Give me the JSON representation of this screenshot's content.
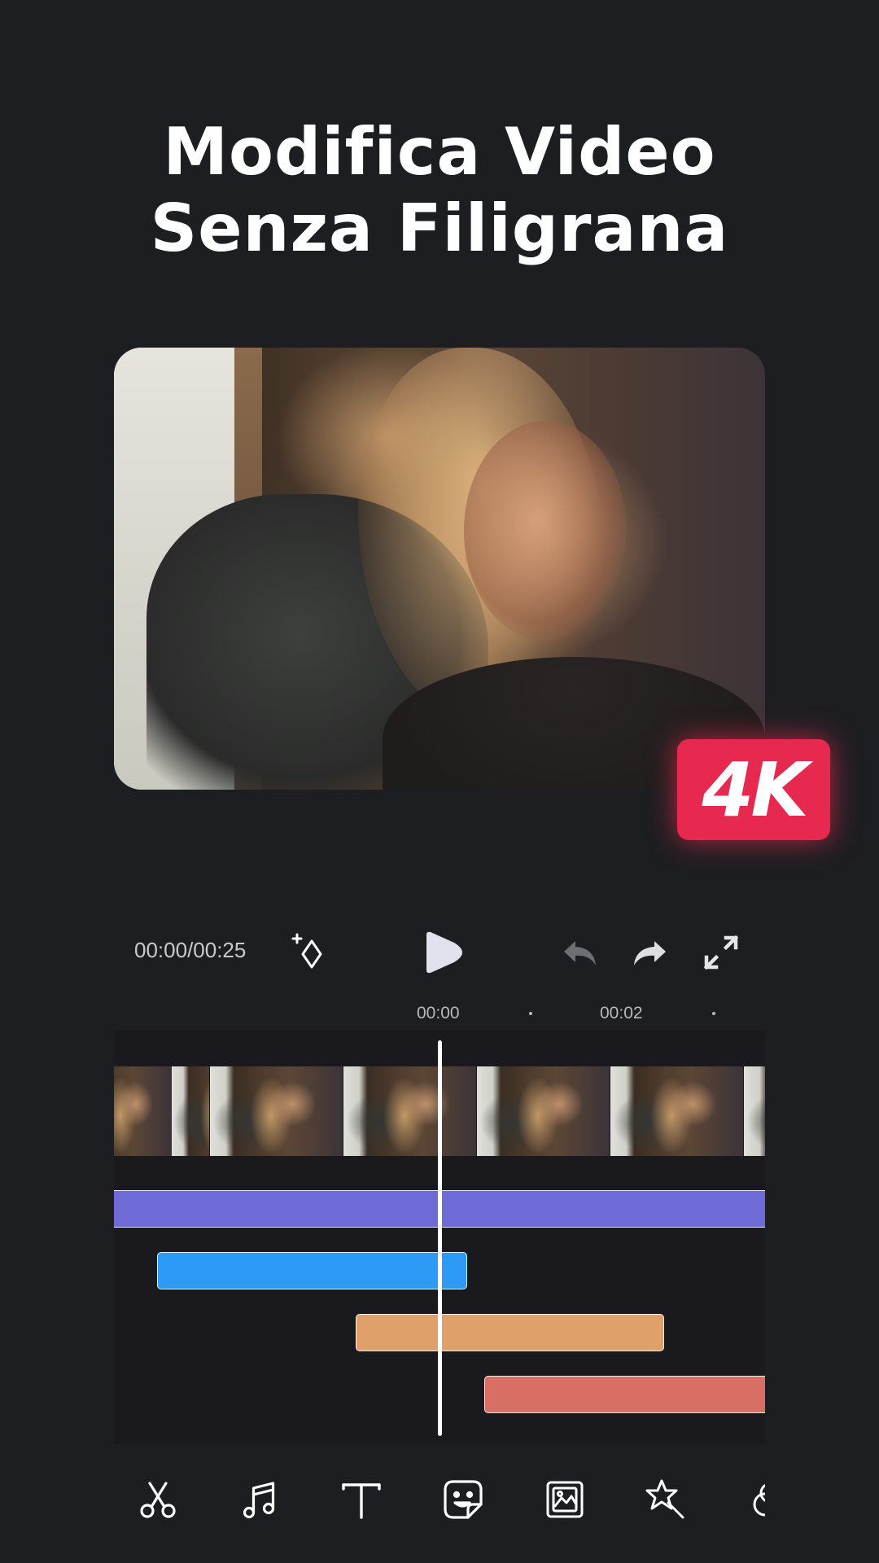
{
  "headline": {
    "line1": "Modifica Video",
    "line2": "Senza Filigrana"
  },
  "preview": {
    "badge": "4K",
    "badge_color": "#e8294f"
  },
  "player": {
    "time": "00:00/00:25",
    "icons": [
      "add-keyframe-icon",
      "play-icon",
      "undo-icon",
      "redo-icon",
      "fullscreen-icon"
    ]
  },
  "timeline": {
    "ruler_labels": [
      "00:00",
      "00:02"
    ],
    "tracks": [
      {
        "color": "#6f6bd6"
      },
      {
        "color": "#2d9bf5"
      },
      {
        "color": "#dfa06a"
      },
      {
        "color": "#d86f64"
      }
    ]
  },
  "toolbar": {
    "tools": [
      "scissors-icon",
      "music-note-icon",
      "text-icon",
      "sticker-icon",
      "image-icon",
      "magic-wand-icon",
      "filter-icon"
    ]
  },
  "colors": {
    "background": "#1d1e21",
    "accent": "#e8294f"
  }
}
